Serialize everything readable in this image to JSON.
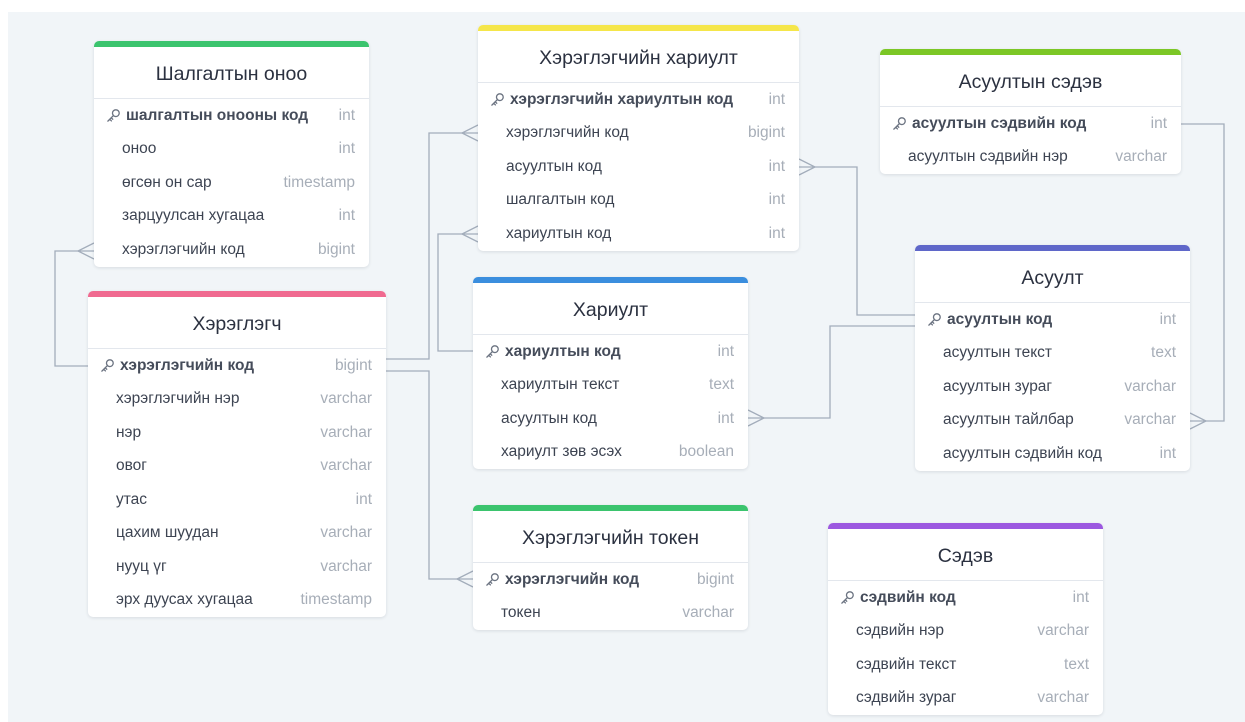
{
  "tables": {
    "shalgalt_onoo": {
      "title": "Шалгалтын оноо",
      "color": "#3bc46e",
      "rows": [
        {
          "name": "шалгалтын онооны код",
          "type": "int",
          "pk": true
        },
        {
          "name": "оноо",
          "type": "int"
        },
        {
          "name": "өгсөн он сар",
          "type": "timestamp"
        },
        {
          "name": "зарцуулсан хугацаа",
          "type": "int"
        },
        {
          "name": "хэрэглэгчийн код",
          "type": "bigint"
        }
      ]
    },
    "hereglegch": {
      "title": "Хэрэглэгч",
      "color": "#f06a90",
      "rows": [
        {
          "name": "хэрэглэгчийн код",
          "type": "bigint",
          "pk": true
        },
        {
          "name": "хэрэглэгчийн нэр",
          "type": "varchar"
        },
        {
          "name": "нэр",
          "type": "varchar"
        },
        {
          "name": "овог",
          "type": "varchar"
        },
        {
          "name": "утас",
          "type": "int"
        },
        {
          "name": "цахим шуудан",
          "type": "varchar"
        },
        {
          "name": "нууц үг",
          "type": "varchar"
        },
        {
          "name": "эрх дуусах хугацаа",
          "type": "timestamp"
        }
      ]
    },
    "hereglegch_hariult": {
      "title": "Хэрэглэгчийн хариулт",
      "color": "#f5e64a",
      "rows": [
        {
          "name": "хэрэглэгчийн хариултын код",
          "type": "int",
          "pk": true
        },
        {
          "name": "хэрэглэгчийн код",
          "type": "bigint"
        },
        {
          "name": "асуултын код",
          "type": "int"
        },
        {
          "name": "шалгалтын код",
          "type": "int"
        },
        {
          "name": "хариултын код",
          "type": "int"
        }
      ]
    },
    "hariult": {
      "title": "Хариулт",
      "color": "#3b8ede",
      "rows": [
        {
          "name": "хариултын код",
          "type": "int",
          "pk": true
        },
        {
          "name": "хариултын текст",
          "type": "text"
        },
        {
          "name": "асуултын код",
          "type": "int"
        },
        {
          "name": "хариулт зөв эсэх",
          "type": "boolean"
        }
      ]
    },
    "hereglegch_token": {
      "title": "Хэрэглэгчийн токен",
      "color": "#3bc46e",
      "rows": [
        {
          "name": "хэрэглэгчийн код",
          "type": "bigint",
          "pk": true
        },
        {
          "name": "токен",
          "type": "varchar"
        }
      ]
    },
    "asuult_sedev": {
      "title": "Асуултын сэдэв",
      "color": "#7cc726",
      "rows": [
        {
          "name": "асуултын сэдвийн код",
          "type": "int",
          "pk": true
        },
        {
          "name": "асуултын сэдвийн нэр",
          "type": "varchar"
        }
      ]
    },
    "asuult": {
      "title": "Асуулт",
      "color": "#5f67c9",
      "rows": [
        {
          "name": "асуултын код",
          "type": "int",
          "pk": true
        },
        {
          "name": "асуултын текст",
          "type": "text"
        },
        {
          "name": "асуултын зураг",
          "type": "varchar"
        },
        {
          "name": "асуултын тайлбар",
          "type": "varchar"
        },
        {
          "name": "асуултын сэдвийн код",
          "type": "int"
        }
      ]
    },
    "sedev": {
      "title": "Сэдэв",
      "color": "#9c58e0",
      "rows": [
        {
          "name": "сэдвийн код",
          "type": "int",
          "pk": true
        },
        {
          "name": "сэдвийн нэр",
          "type": "varchar"
        },
        {
          "name": "сэдвийн текст",
          "type": "text"
        },
        {
          "name": "сэдвийн зураг",
          "type": "varchar"
        }
      ]
    }
  },
  "colors": {
    "canvas": "#f1f5f8",
    "connector": "#a3adbb"
  }
}
